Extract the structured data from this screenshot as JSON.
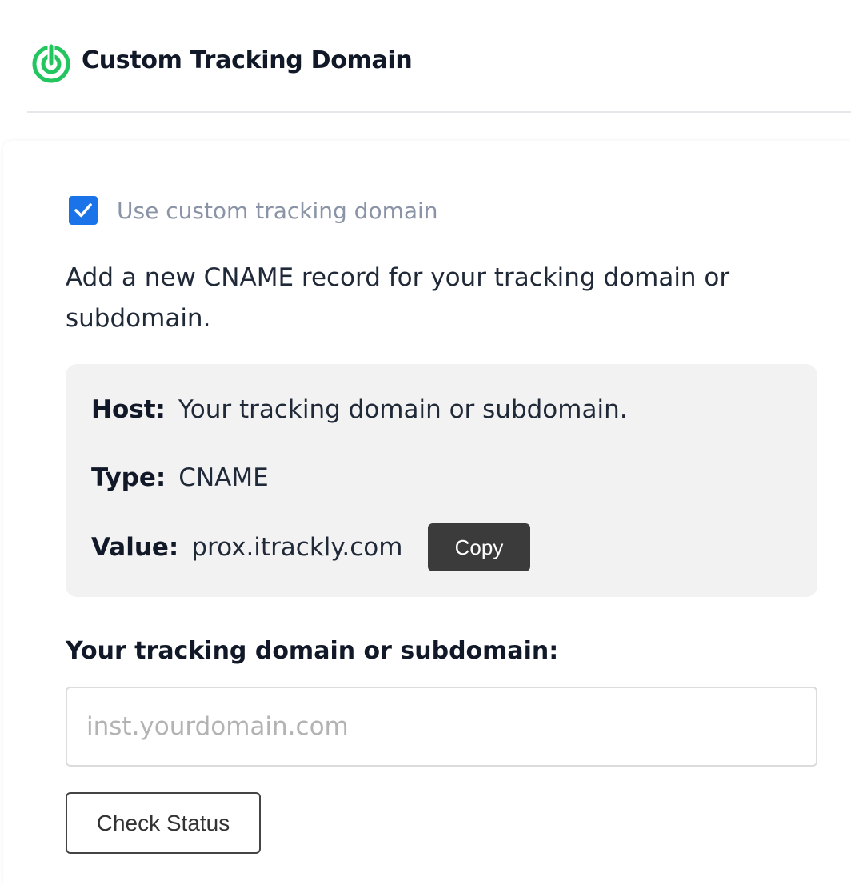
{
  "header": {
    "title": "Custom Tracking Domain",
    "logo_icon": "target-logo-icon",
    "accent_color": "#22c55e"
  },
  "settings": {
    "use_custom_domain": {
      "label": "Use custom tracking domain",
      "checked": true,
      "color": "#1a73e8"
    },
    "instructions": "Add a new CNAME record for your tracking domain or subdomain.",
    "record": {
      "host_label": "Host:",
      "host_value": "Your tracking domain or subdomain.",
      "type_label": "Type:",
      "type_value": "CNAME",
      "value_label": "Value:",
      "value_value": "prox.itrackly.com",
      "copy_label": "Copy"
    },
    "domain_field": {
      "label": "Your tracking domain or subdomain:",
      "placeholder": "inst.yourdomain.com",
      "value": ""
    },
    "check_status_label": "Check Status"
  }
}
